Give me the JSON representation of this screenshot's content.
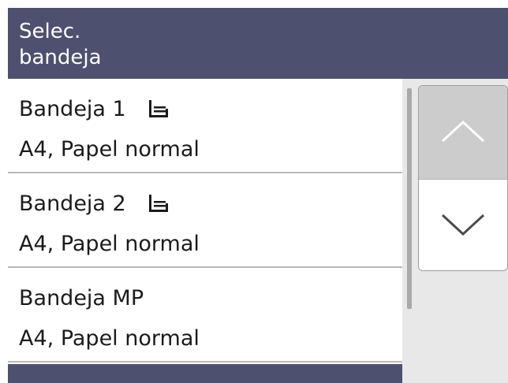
{
  "header": {
    "title": "Selec.\nbandeja"
  },
  "tray_list": {
    "items": [
      {
        "name": "Bandeja 1",
        "detail": "A4, Papel normal",
        "icon": "tray-icon"
      },
      {
        "name": "Bandeja 2",
        "detail": "A4, Papel normal",
        "icon": "tray-icon"
      },
      {
        "name": "Bandeja MP",
        "detail": "A4, Papel normal"
      }
    ]
  },
  "scroll": {
    "up_icon": "chevron-up-icon",
    "down_icon": "chevron-down-icon"
  },
  "colors": {
    "header_bg": "#4d506e",
    "selection_bar": "#4d506e",
    "panel_bg": "#e8e8e8",
    "up_button_bg": "#cccccc"
  }
}
